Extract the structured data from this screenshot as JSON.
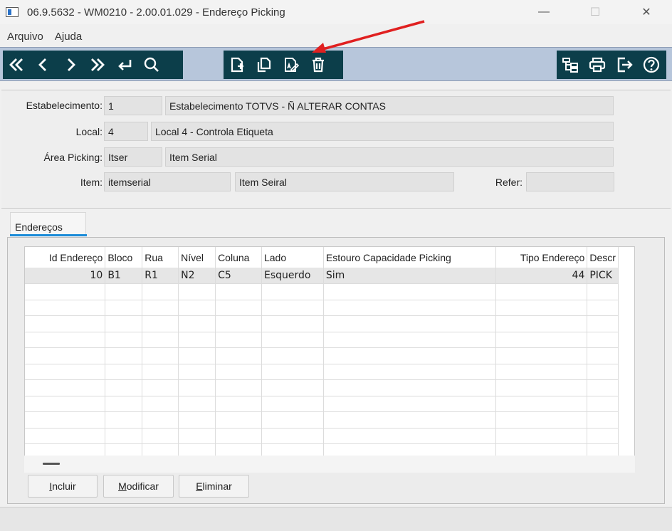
{
  "window": {
    "title": "06.9.5632 - WM0210 - 2.00.01.029 - Endereço Picking",
    "minimize": "—",
    "maximize": "☐",
    "close": "✕"
  },
  "menu": [
    "Arquivo",
    "Ajuda"
  ],
  "toolbar": {
    "nav": [
      "first-icon",
      "previous-icon",
      "next-icon",
      "last-icon",
      "goto-icon",
      "search-icon"
    ],
    "edit": [
      "new-icon",
      "copy-icon",
      "edit-icon",
      "delete-icon"
    ],
    "right": [
      "tree-icon",
      "print-icon",
      "exit-icon",
      "help-icon"
    ],
    "color_bg": "#0c3e4a",
    "color_bar": "#b7c6db"
  },
  "form": {
    "estabelecimento": {
      "label": "Estabelecimento:",
      "code": "1",
      "desc": "Estabelecimento TOTVS - Ñ ALTERAR CONTAS"
    },
    "local": {
      "label": "Local:",
      "code": "4",
      "desc": "Local 4 - Controla Etiqueta"
    },
    "area": {
      "label": "Área Picking:",
      "code": "Itser",
      "desc": "Item Serial"
    },
    "item": {
      "label": "Item:",
      "code": "itemserial",
      "desc": "Item Seiral"
    },
    "refer": {
      "label": "Refer:",
      "value": ""
    }
  },
  "tabs": [
    "Endereços"
  ],
  "grid": {
    "columns": [
      "Id Endereço",
      "Bloco",
      "Rua",
      "Nível",
      "Coluna",
      "Lado",
      "Estouro Capacidade Picking",
      "Tipo Endereço",
      "Descr"
    ],
    "rows": [
      [
        "10",
        "B1",
        "R1",
        "N2",
        "C5",
        "Esquerdo",
        "Sim",
        "44",
        "PICK"
      ]
    ],
    "empty_rows": 11
  },
  "buttons": {
    "incluir": {
      "u": "I",
      "rest": "ncluir"
    },
    "modificar": {
      "u": "M",
      "rest": "odificar"
    },
    "eliminar": {
      "u": "E",
      "rest": "liminar"
    }
  },
  "annotation_color": "#e02020"
}
